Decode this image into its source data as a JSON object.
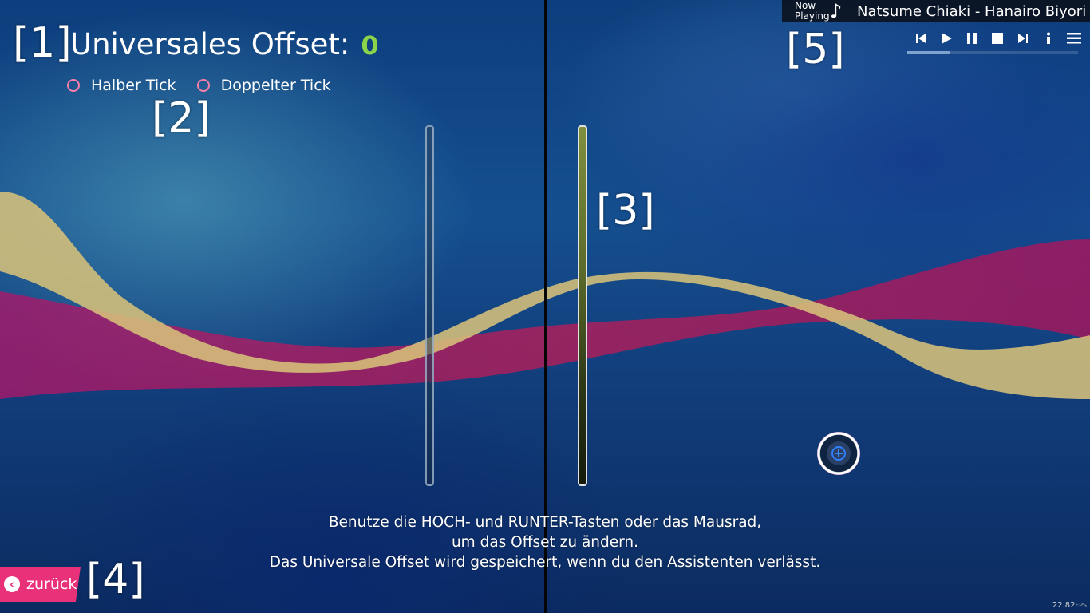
{
  "markers": {
    "m1": "[1]",
    "m2": "[2]",
    "m3": "[3]",
    "m4": "[4]",
    "m5": "[5]"
  },
  "offset": {
    "label": "Universales Offset:",
    "value": "0"
  },
  "options": [
    {
      "label": "Halber Tick",
      "checked": false
    },
    {
      "label": "Doppelter Tick",
      "checked": false
    }
  ],
  "instructions": {
    "line1": "Benutze die HOCH- und RUNTER-Tasten oder das Mausrad,",
    "line2": "um das Offset zu ändern.",
    "line3": "Das Universale Offset wird gespeichert, wenn du den Assistenten verlässt."
  },
  "back_button": {
    "label": "zurück",
    "icon": "chevron-left-icon"
  },
  "now_playing": {
    "label_line1": "Now",
    "label_line2": "Playing",
    "song": "Natsume Chiaki - Hanairo Biyori",
    "progress_fraction": 0.25
  },
  "controls": [
    "previous-icon",
    "play-icon",
    "pause-icon",
    "stop-icon",
    "next-icon",
    "info-icon",
    "menu-icon"
  ],
  "fps": {
    "value": "22.82",
    "unit": "FPS"
  },
  "colors": {
    "accent_pink": "#e9317a",
    "offset_green": "#8bd44a",
    "wave_pink": "#c2185b",
    "wave_gold": "#d8c27a"
  }
}
